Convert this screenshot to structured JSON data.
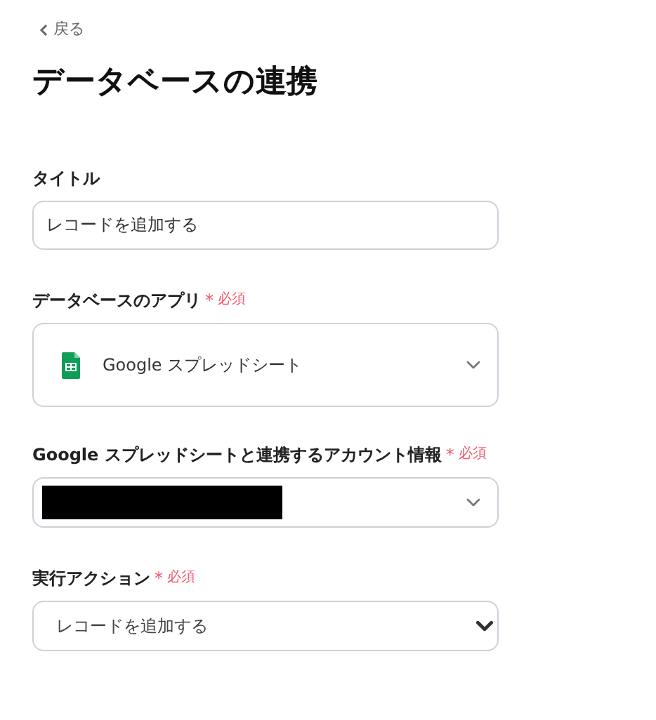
{
  "back_link": {
    "label": "戻る"
  },
  "heading": "データベースの連携",
  "fields": [
    {
      "kind": "text",
      "label": "タイトル",
      "value": "レコードを追加する"
    },
    {
      "kind": "app-select",
      "label": "データベースのアプリ",
      "required_mark": "*",
      "required_label": "必須",
      "value": "Google スプレッドシート"
    },
    {
      "kind": "redacted-select",
      "label": "Google スプレッドシートと連携するアカウント情報",
      "required_mark": "*",
      "required_label": "必須"
    },
    {
      "kind": "select",
      "label": "実行アクション",
      "required_mark": "*",
      "required_label": "必須",
      "value": "レコードを追加する"
    }
  ]
}
